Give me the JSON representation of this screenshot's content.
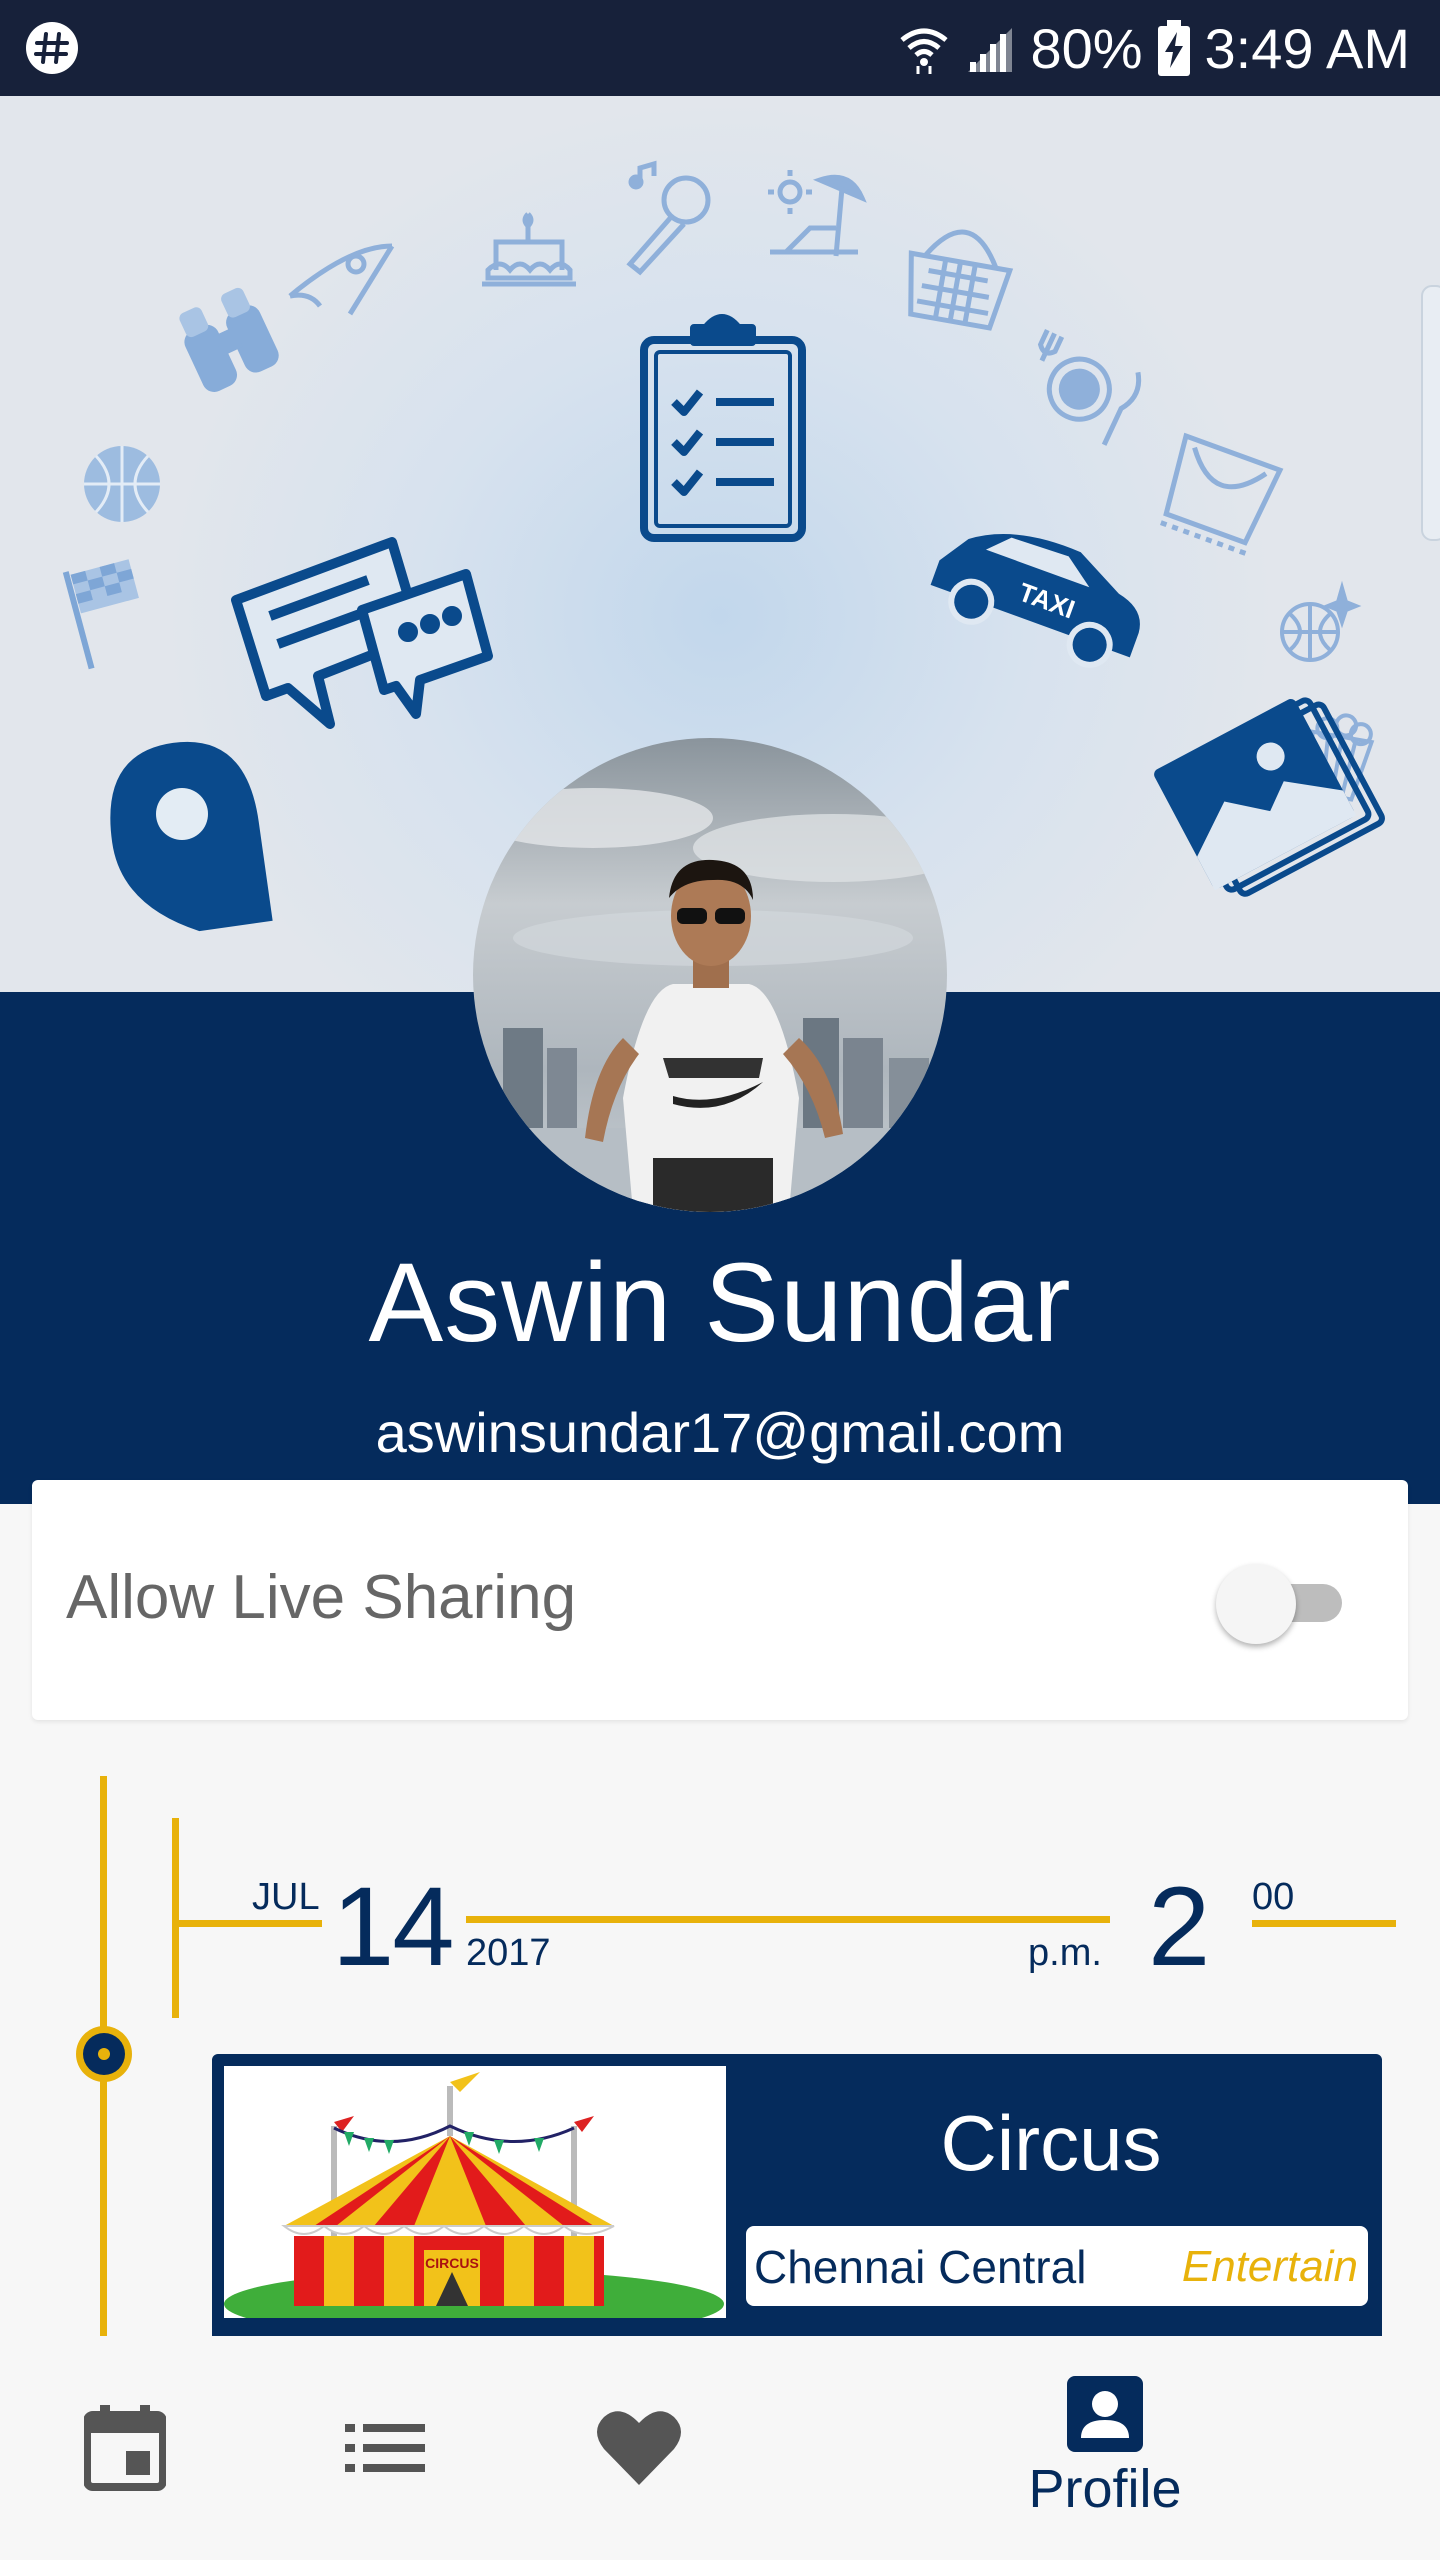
{
  "status_bar": {
    "battery": "80%",
    "time": "3:49 AM",
    "icons": [
      "app-notification-icon",
      "wifi-icon",
      "signal-icon",
      "battery-charging-icon"
    ]
  },
  "profile": {
    "name": "Aswin Sundar",
    "email": "aswinsundar17@gmail.com"
  },
  "live_sharing": {
    "label": "Allow Live Sharing",
    "enabled": false
  },
  "timeline": {
    "month": "JUL",
    "day": "14",
    "year": "2017",
    "ampm": "p.m.",
    "hour": "2",
    "minute": "00",
    "event": {
      "title": "Circus",
      "location": "Chennai Central",
      "category": "Entertain",
      "image_text": "CIRCUS"
    }
  },
  "bottom_nav": {
    "items": [
      {
        "icon": "calendar-icon"
      },
      {
        "icon": "list-icon"
      },
      {
        "icon": "heart-icon"
      },
      {
        "icon": "profile-icon",
        "label": "Profile",
        "active": true
      }
    ]
  },
  "colors": {
    "navy": "#052b5c",
    "accent_yellow": "#e8b20b",
    "status_bar": "#17213a"
  }
}
